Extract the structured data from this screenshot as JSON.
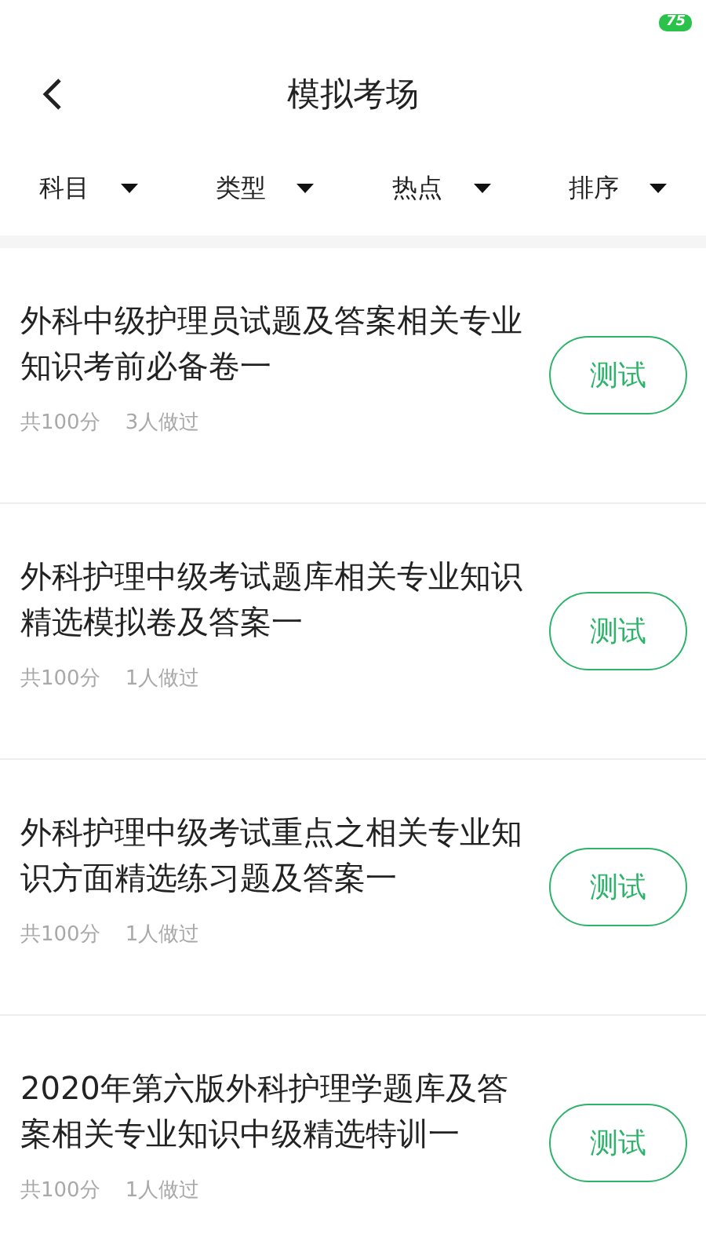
{
  "status_bar": {
    "battery": "75"
  },
  "header": {
    "title": "模拟考场"
  },
  "filters": [
    {
      "label": "科目"
    },
    {
      "label": "类型"
    },
    {
      "label": "热点"
    },
    {
      "label": "排序"
    }
  ],
  "exams": [
    {
      "title": "外科中级护理员试题及答案相关专业知识考前必备卷一",
      "score": "共100分",
      "takers": "3人做过",
      "action": "测试"
    },
    {
      "title": "外科护理中级考试题库相关专业知识精选模拟卷及答案一",
      "score": "共100分",
      "takers": "1人做过",
      "action": "测试"
    },
    {
      "title": "外科护理中级考试重点之相关专业知识方面精选练习题及答案一",
      "score": "共100分",
      "takers": "1人做过",
      "action": "测试"
    },
    {
      "title": "2020年第六版外科护理学题库及答案相关专业知识中级精选特训一",
      "score": "共100分",
      "takers": "1人做过",
      "action": "测试"
    }
  ]
}
